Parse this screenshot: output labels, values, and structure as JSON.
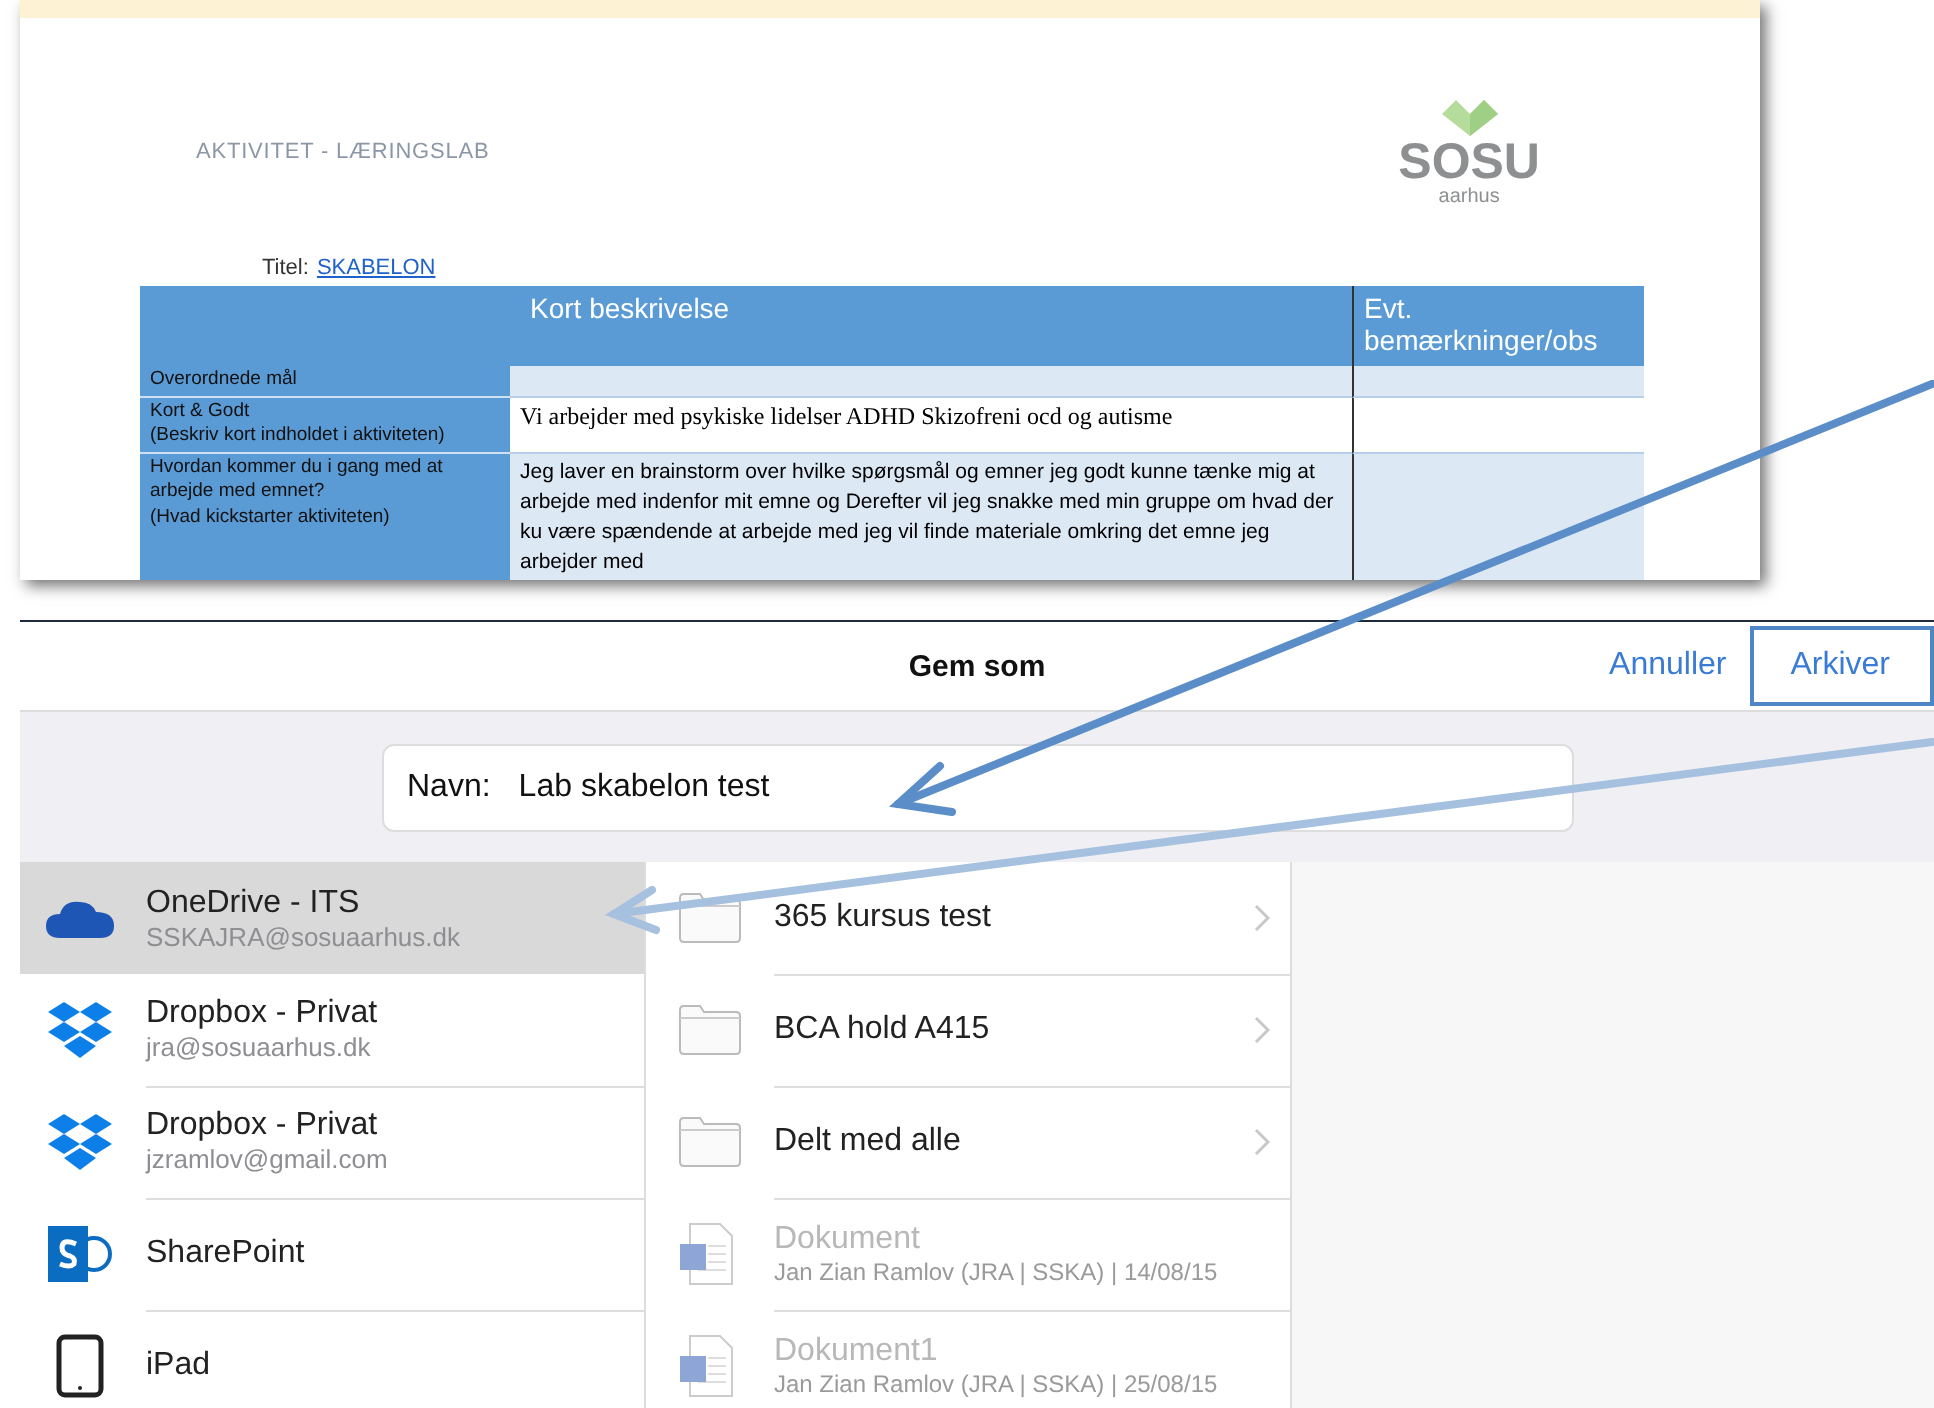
{
  "document": {
    "header": "AKTIVITET - LÆRINGSLAB",
    "logo": {
      "name": "SOSU",
      "sub": "aarhus"
    },
    "title_label": "Titel:",
    "title_value": "SKABELON",
    "table": {
      "columns": [
        "Kort beskrivelse",
        "Evt. bemærkninger/obs"
      ],
      "rows": [
        {
          "label": [
            "Overordnede mål"
          ],
          "content": ""
        },
        {
          "label": [
            "Kort & Godt",
            "(Beskriv kort indholdet i aktiviteten)"
          ],
          "content": "Vi arbejder med psykiske lidelser ADHD Skizofreni  ocd og autisme"
        },
        {
          "label": [
            "Hvordan kommer du i gang med at arbejde med emnet?",
            "(Hvad kickstarter aktiviteten)"
          ],
          "content": "Jeg laver en brainstorm over hvilke spørgsmål og emner jeg godt kunne tænke mig at arbejde med indenfor mit emne og Derefter vil jeg snakke med min gruppe om hvad der ku være spændende at arbejde med  jeg vil finde materiale omkring det emne jeg arbejder med"
        }
      ]
    }
  },
  "dialog": {
    "title": "Gem som",
    "cancel": "Annuller",
    "save": {
      "label": "Arkiver",
      "highlighted": true
    },
    "name_label": "Navn:",
    "name_value": "Lab skabelon test",
    "locations": [
      {
        "kind": "onedrive",
        "name": "OneDrive - ITS",
        "account": "SSKAJRA@sosuaarhus.dk",
        "selected": true
      },
      {
        "kind": "dropbox",
        "name": "Dropbox - Privat",
        "account": "jra@sosuaarhus.dk",
        "selected": false
      },
      {
        "kind": "dropbox",
        "name": "Dropbox - Privat",
        "account": "jzramlov@gmail.com",
        "selected": false
      },
      {
        "kind": "sharepoint",
        "name": "SharePoint",
        "selected": false
      },
      {
        "kind": "device",
        "name": "iPad",
        "selected": false
      }
    ],
    "items": [
      {
        "kind": "folder",
        "name": "365 kursus test",
        "disabled": false
      },
      {
        "kind": "folder",
        "name": "BCA hold A415",
        "disabled": false
      },
      {
        "kind": "folder",
        "name": "Delt med alle",
        "disabled": false
      },
      {
        "kind": "document",
        "name": "Dokument",
        "meta": "Jan Zian Ramlov (JRA | SSKA) | 14/08/15",
        "disabled": true
      },
      {
        "kind": "document",
        "name": "Dokument1",
        "meta": "Jan Zian Ramlov (JRA | SSKA) | 25/08/15",
        "disabled": true
      }
    ]
  }
}
